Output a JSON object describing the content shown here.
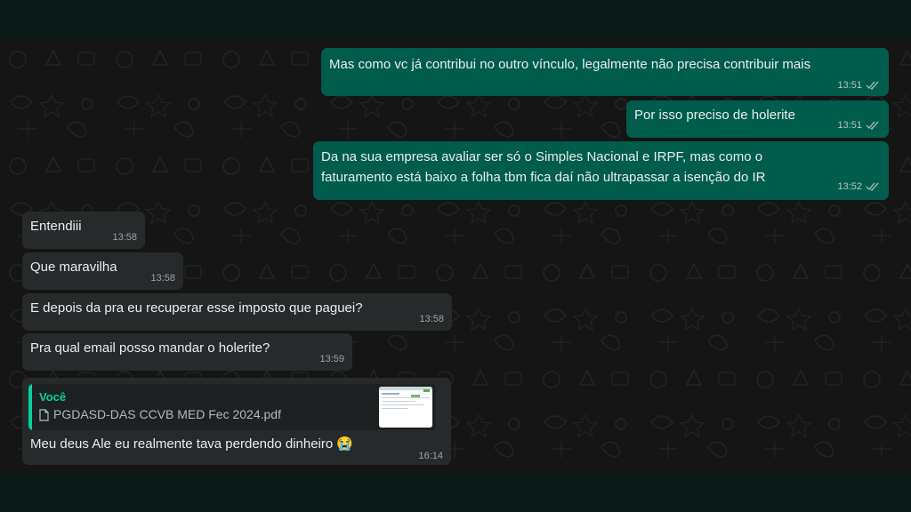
{
  "messages": [
    {
      "direction": "outgoing",
      "lines": [
        "Mas como vc já contribui no outro vínculo, legalmente não precisa contribuir mais"
      ],
      "time": "13:51"
    },
    {
      "direction": "outgoing",
      "lines": [
        "Por isso preciso de holerite"
      ],
      "time": "13:51"
    },
    {
      "direction": "outgoing",
      "lines": [
        "Da na sua empresa avaliar ser só o Simples Nacional e IRPF, mas como o",
        "faturamento está baixo a folha tbm fica daí não ultrapassar a isenção do IR"
      ],
      "time": "13:52"
    },
    {
      "direction": "incoming",
      "lines": [
        "Entendiii"
      ],
      "time": "13:58"
    },
    {
      "direction": "incoming",
      "lines": [
        "Que maravilha"
      ],
      "time": "13:58"
    },
    {
      "direction": "incoming",
      "lines": [
        "E depois da pra eu recuperar esse imposto que paguei?"
      ],
      "time": "13:58"
    },
    {
      "direction": "incoming",
      "lines": [
        "Pra qual email posso mandar o holerite?"
      ],
      "time": "13:59"
    },
    {
      "direction": "incoming",
      "quote": {
        "author": "Você",
        "file": "PGDASD-DAS CCVB MED Fec 2024.pdf",
        "icon": "document-icon"
      },
      "lines": [
        "Meu deus Ale eu realmente tava perdendo dinheiro 😭"
      ],
      "time": "16:14"
    }
  ],
  "colors": {
    "outgoing_bubble": "#005c4b",
    "incoming_bubble": "#262a2b",
    "quote_accent": "#06cf9c",
    "background": "#151515"
  },
  "icons": {
    "read_receipt": "double-check-icon",
    "attachment": "document-icon"
  }
}
